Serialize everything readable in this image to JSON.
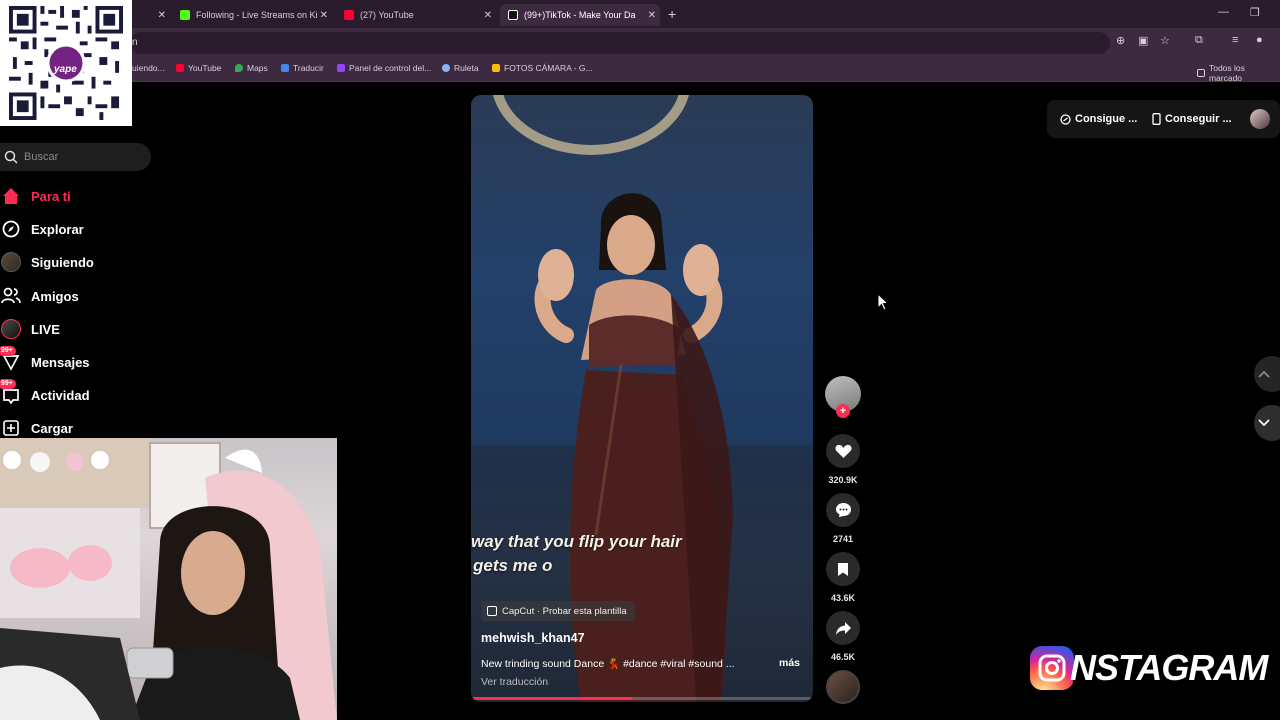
{
  "browser": {
    "tabs": [
      {
        "label": "",
        "active": false
      },
      {
        "label": "Following - Live Streams on Ki",
        "active": false,
        "color": "#53fc18"
      },
      {
        "label": "(27) YouTube",
        "active": false,
        "color": "#ff0033"
      },
      {
        "label": "(99+)TikTok - Make Your Da",
        "active": true,
        "color": "#ffffff"
      }
    ],
    "omnibox_text": "n",
    "bookmarks": [
      {
        "label": "uiendo...",
        "color": "#888888"
      },
      {
        "label": "YouTube",
        "color": "#ff0033"
      },
      {
        "label": "Maps",
        "color": "#34a853"
      },
      {
        "label": "Traducir",
        "color": "#4285f4"
      },
      {
        "label": "Panel de control del...",
        "color": "#9146ff"
      },
      {
        "label": "Ruleta",
        "color": "#8ab4f8"
      },
      {
        "label": "FOTOS CÁMARA - G...",
        "color": "#fbbc04"
      }
    ],
    "all_bookmarks": "Todos los marcado"
  },
  "qr": {
    "brand": "yape"
  },
  "sidebar": {
    "search_placeholder": "Buscar",
    "items": [
      {
        "label": "Para ti",
        "icon": "home-icon",
        "active": true
      },
      {
        "label": "Explorar",
        "icon": "compass-icon"
      },
      {
        "label": "Siguiendo",
        "icon": "following-avatar-icon"
      },
      {
        "label": "Amigos",
        "icon": "friends-icon"
      },
      {
        "label": "LIVE",
        "icon": "live-avatar-icon"
      },
      {
        "label": "Mensajes",
        "icon": "message-icon",
        "badge": "99+"
      },
      {
        "label": "Actividad",
        "icon": "inbox-icon",
        "badge": "99+"
      },
      {
        "label": "Cargar",
        "icon": "upload-icon"
      }
    ]
  },
  "topbar": {
    "get_coins": "Consigue ...",
    "get_app": "Conseguir ..."
  },
  "video": {
    "lyric_line1": "way that you flip your hair",
    "lyric_line2": "gets me o",
    "capcut": "CapCut · Probar esta plantilla",
    "author": "mehwish_khan47",
    "description": "New trinding sound Dance 💃 #dance #viral #sound ...",
    "more": "más",
    "translate": "Ver traducción",
    "progress": 0.47
  },
  "actions": {
    "likes": "320.9K",
    "comments": "2741",
    "saves": "43.6K",
    "shares": "46.5K"
  },
  "overlay": {
    "instagram": "NSTAGRAM"
  },
  "colors": {
    "accent": "#fe2c55",
    "chrome_tabbar": "#2a1b2d",
    "chrome_toolbar": "#3d2a40"
  }
}
